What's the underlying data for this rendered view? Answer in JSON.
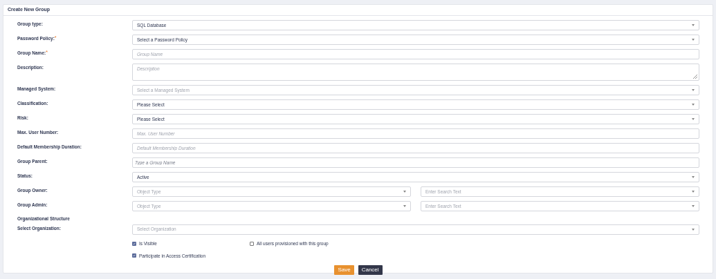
{
  "title": "Create New Group",
  "rows": [
    {
      "kind": "select",
      "label": "Group type:",
      "value": "SQL Database"
    },
    {
      "kind": "select",
      "label": "Password Policy:",
      "required_mark": "*",
      "value": "Select a Password Policy"
    },
    {
      "kind": "input",
      "label": "Group Name:",
      "required_mark": "*",
      "placeholder": "Group Name"
    },
    {
      "kind": "textarea",
      "label": "Description:",
      "placeholder": "Description"
    },
    {
      "kind": "select",
      "label": "Managed System:",
      "placeholder": "Select a Managed System"
    },
    {
      "kind": "select",
      "label": "Classification:",
      "value": "Please Select"
    },
    {
      "kind": "select",
      "label": "Risk:",
      "value": "Please Select"
    },
    {
      "kind": "input",
      "label": "Max. User Number:",
      "placeholder": "Max. User Number"
    },
    {
      "kind": "input",
      "label": "Default Membership Duration:",
      "placeholder": "Default Membership Duration"
    },
    {
      "kind": "search",
      "label": "Group Parent:",
      "placeholder": "Type a Group Name"
    },
    {
      "kind": "select",
      "label": "Status:",
      "value": "Active"
    },
    {
      "kind": "pair",
      "label": "Group Owner:",
      "placeholder": "Object Type",
      "placeholder_2": "Enter Search Text"
    },
    {
      "kind": "pair",
      "label": "Group Admin:",
      "placeholder": "Object Type",
      "placeholder_2": "Enter Search Text"
    },
    {
      "kind": "section",
      "label": "Organizational Structure"
    },
    {
      "kind": "select",
      "label": "Select Organization:",
      "placeholder": "Select Organization"
    }
  ],
  "checkbox_rows": [
    [
      {
        "label": "Is Visible",
        "checked": true
      },
      {
        "label": "All users provisioned with this group",
        "checked": false
      }
    ],
    [
      {
        "label": "Participate in Access Certification",
        "checked": true
      }
    ]
  ],
  "buttons": [
    {
      "label": "Save",
      "kind": "primary"
    },
    {
      "label": "Cancel",
      "kind": "secondary"
    }
  ]
}
